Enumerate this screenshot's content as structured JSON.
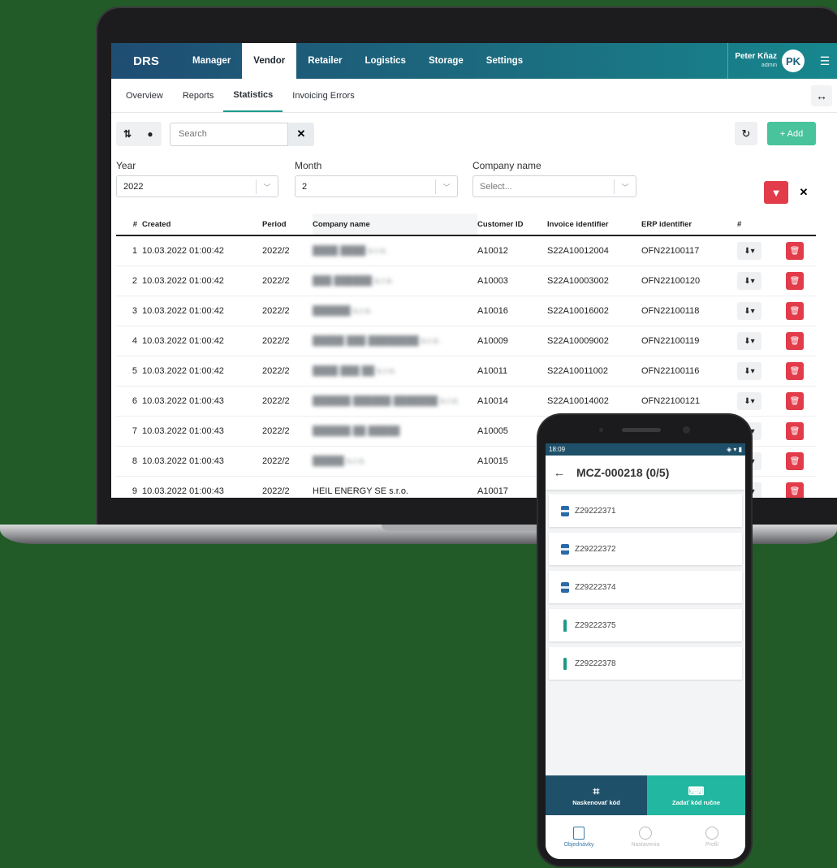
{
  "app": {
    "brand": "DRS",
    "nav": [
      "Manager",
      "Vendor",
      "Retailer",
      "Logistics",
      "Storage",
      "Settings"
    ],
    "active_nav": "Vendor",
    "user": {
      "name": "Peter Kňaz",
      "role": "admin",
      "initials": "PK"
    }
  },
  "subtabs": [
    "Overview",
    "Reports",
    "Statistics",
    "Invoicing Errors"
  ],
  "active_subtab": "Statistics",
  "toolbar": {
    "search_placeholder": "Search",
    "clear_glyph": "✕",
    "refresh_glyph": "↻",
    "add_label": "+ Add"
  },
  "filters": {
    "year": {
      "label": "Year",
      "value": "2022"
    },
    "month": {
      "label": "Month",
      "value": "2"
    },
    "company": {
      "label": "Company name",
      "placeholder": "Select..."
    }
  },
  "table": {
    "headers": [
      "#",
      "Created",
      "Period",
      "Company name",
      "Customer ID",
      "Invoice identifier",
      "ERP identifier",
      "#"
    ],
    "rows": [
      {
        "n": "1",
        "created": "10.03.2022 01:00:42",
        "period": "2022/2",
        "company": "████ ████ s.r.o.",
        "customer": "A10012",
        "invoice": "S22A10012004",
        "erp": "OFN22100117"
      },
      {
        "n": "2",
        "created": "10.03.2022 01:00:42",
        "period": "2022/2",
        "company": "███ ██████ s.r.o.",
        "customer": "A10003",
        "invoice": "S22A10003002",
        "erp": "OFN22100120"
      },
      {
        "n": "3",
        "created": "10.03.2022 01:00:42",
        "period": "2022/2",
        "company": "██████ s.r.o.",
        "customer": "A10016",
        "invoice": "S22A10016002",
        "erp": "OFN22100118"
      },
      {
        "n": "4",
        "created": "10.03.2022 01:00:42",
        "period": "2022/2",
        "company": "█████ ███ ████████ s.r.o.",
        "customer": "A10009",
        "invoice": "S22A10009002",
        "erp": "OFN22100119"
      },
      {
        "n": "5",
        "created": "10.03.2022 01:00:42",
        "period": "2022/2",
        "company": "████ ███ ██ s.r.o.",
        "customer": "A10011",
        "invoice": "S22A10011002",
        "erp": "OFN22100116"
      },
      {
        "n": "6",
        "created": "10.03.2022 01:00:43",
        "period": "2022/2",
        "company": "██████ ██████ ███████ s.r.o.",
        "customer": "A10014",
        "invoice": "S22A10014002",
        "erp": "OFN22100121"
      },
      {
        "n": "7",
        "created": "10.03.2022 01:00:43",
        "period": "2022/2",
        "company": "██████ ██ █████",
        "customer": "A10005",
        "invoice": "",
        "erp": ""
      },
      {
        "n": "8",
        "created": "10.03.2022 01:00:43",
        "period": "2022/2",
        "company": "█████ s.r.o.",
        "customer": "A10015",
        "invoice": "",
        "erp": ""
      },
      {
        "n": "9",
        "created": "10.03.2022 01:00:43",
        "period": "2022/2",
        "company": "HEIL ENERGY SE s.r.o.",
        "customer": "A10017",
        "invoice": "",
        "erp": ""
      }
    ]
  },
  "mobile": {
    "status_time": "18:09",
    "title": "MCZ-000218 (0/5)",
    "codes": [
      {
        "code": "Z29222371",
        "type": "can"
      },
      {
        "code": "Z29222372",
        "type": "can"
      },
      {
        "code": "Z29222374",
        "type": "can"
      },
      {
        "code": "Z29222375",
        "type": "bottle"
      },
      {
        "code": "Z29222378",
        "type": "bottle"
      }
    ],
    "scan_label": "Naskenovať kód",
    "manual_label": "Zadať kód ručne",
    "bottom_nav": [
      "Objednávky",
      "Nastavenia",
      "Profil"
    ],
    "active_bottom_nav": "Objednávky"
  }
}
